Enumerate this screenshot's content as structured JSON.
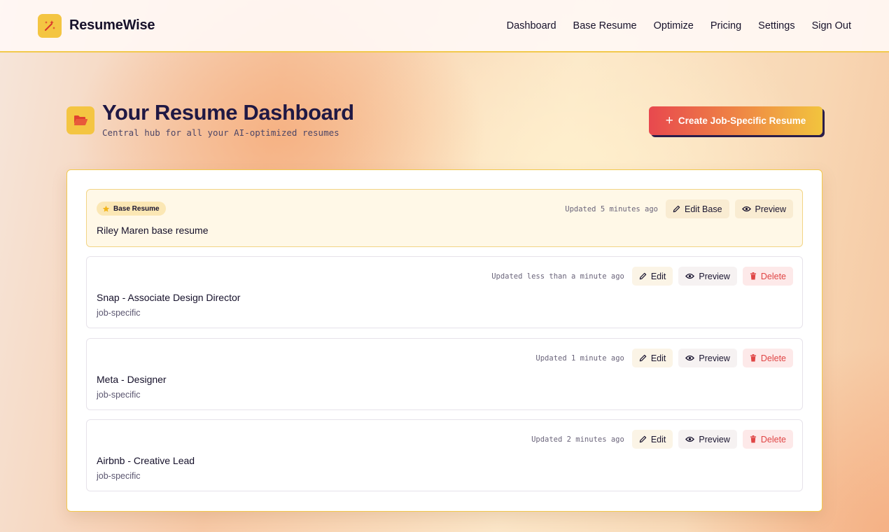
{
  "header": {
    "brand": "ResumeWise",
    "nav": [
      "Dashboard",
      "Base Resume",
      "Optimize",
      "Pricing",
      "Settings",
      "Sign Out"
    ]
  },
  "page": {
    "title": "Your Resume Dashboard",
    "subtitle": "Central hub for all your AI-optimized resumes",
    "create_button": "Create Job-Specific Resume"
  },
  "base_resume": {
    "badge": "Base Resume",
    "title": "Riley Maren base resume",
    "updated": "Updated 5 minutes ago",
    "edit_label": "Edit Base",
    "preview_label": "Preview"
  },
  "resumes": [
    {
      "title": "Snap - Associate Design Director",
      "type": "job-specific",
      "updated": "Updated less than a minute ago",
      "edit_label": "Edit",
      "preview_label": "Preview",
      "delete_label": "Delete"
    },
    {
      "title": "Meta - Designer",
      "type": "job-specific",
      "updated": "Updated 1 minute ago",
      "edit_label": "Edit",
      "preview_label": "Preview",
      "delete_label": "Delete"
    },
    {
      "title": "Airbnb - Creative Lead",
      "type": "job-specific",
      "updated": "Updated 2 minutes ago",
      "edit_label": "Edit",
      "preview_label": "Preview",
      "delete_label": "Delete"
    }
  ],
  "colors": {
    "accent_yellow": "#f4c542",
    "header_border": "#f2c94c",
    "delete_red": "#e04545",
    "title_navy": "#1f1844"
  },
  "icons": {
    "brand": "magic-wand-icon",
    "title": "folder-open-icon",
    "create": "plus-icon",
    "badge": "star-icon",
    "edit": "pencil-icon",
    "preview": "eye-icon",
    "delete": "trash-icon"
  }
}
